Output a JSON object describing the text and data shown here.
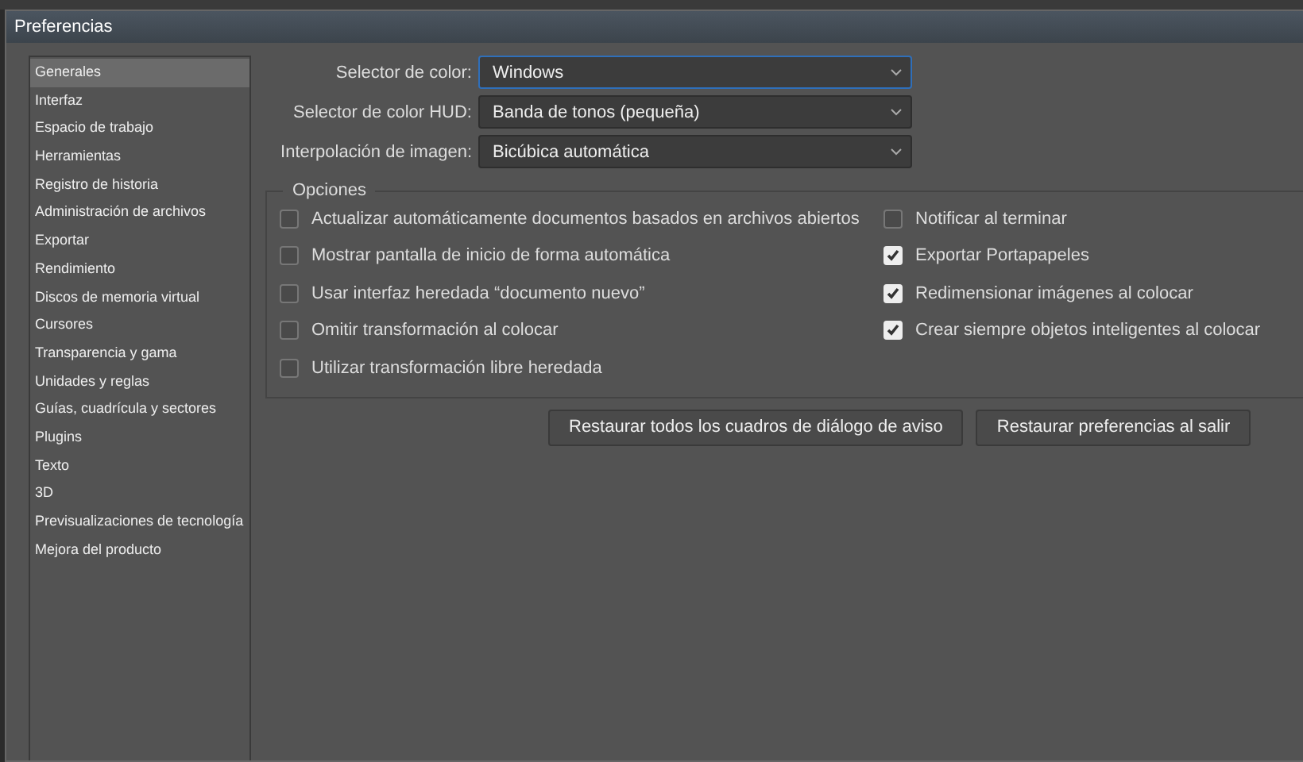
{
  "window": {
    "title": "Preferencias"
  },
  "sidebar": {
    "items": [
      {
        "label": "Generales",
        "selected": true
      },
      {
        "label": "Interfaz",
        "selected": false
      },
      {
        "label": "Espacio de trabajo",
        "selected": false
      },
      {
        "label": "Herramientas",
        "selected": false
      },
      {
        "label": "Registro de historia",
        "selected": false
      },
      {
        "label": "Administración de archivos",
        "selected": false
      },
      {
        "label": "Exportar",
        "selected": false
      },
      {
        "label": "Rendimiento",
        "selected": false
      },
      {
        "label": "Discos de memoria virtual",
        "selected": false
      },
      {
        "label": "Cursores",
        "selected": false
      },
      {
        "label": "Transparencia y gama",
        "selected": false
      },
      {
        "label": "Unidades y reglas",
        "selected": false
      },
      {
        "label": "Guías, cuadrícula y sectores",
        "selected": false
      },
      {
        "label": "Plugins",
        "selected": false
      },
      {
        "label": "Texto",
        "selected": false
      },
      {
        "label": "3D",
        "selected": false
      },
      {
        "label": "Previsualizaciones de tecnología",
        "selected": false
      },
      {
        "label": "Mejora del producto",
        "selected": false
      }
    ]
  },
  "fields": [
    {
      "label": "Selector de color:",
      "value": "Windows",
      "focused": true
    },
    {
      "label": "Selector de color HUD:",
      "value": "Banda de tonos (pequeña)",
      "focused": false
    },
    {
      "label": "Interpolación de imagen:",
      "value": "Bicúbica automática",
      "focused": false
    }
  ],
  "options": {
    "title": "Opciones",
    "left": [
      {
        "label": "Actualizar automáticamente documentos basados en archivos abiertos",
        "checked": false
      },
      {
        "label": "Mostrar pantalla de inicio de forma automática",
        "checked": false
      },
      {
        "label": "Usar interfaz heredada “documento nuevo”",
        "checked": false
      },
      {
        "label": "Omitir transformación al colocar",
        "checked": false
      },
      {
        "label": "Utilizar transformación libre heredada",
        "checked": false
      }
    ],
    "right": [
      {
        "label": "Notificar al terminar",
        "checked": false
      },
      {
        "label": "Exportar Portapapeles",
        "checked": true
      },
      {
        "label": "Redimensionar imágenes al colocar",
        "checked": true
      },
      {
        "label": "Crear siempre objetos inteligentes al colocar",
        "checked": true
      }
    ]
  },
  "buttons": [
    "Restaurar todos los cuadros de diálogo de aviso",
    "Restaurar preferencias al salir"
  ]
}
